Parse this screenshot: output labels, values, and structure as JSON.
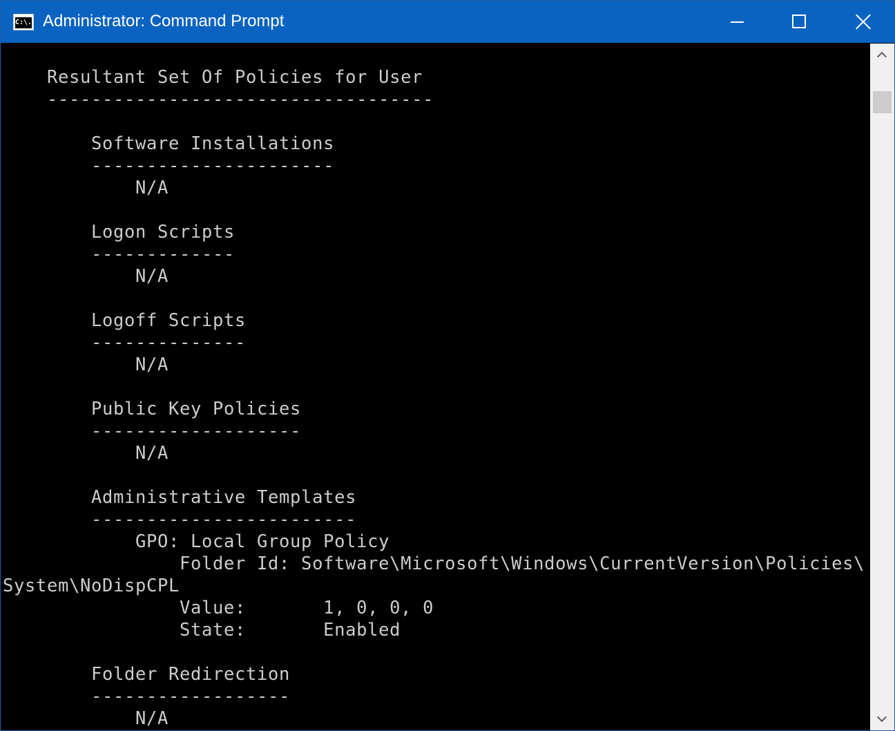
{
  "window": {
    "title": "Administrator: Command Prompt",
    "icon": "cmd-app-icon",
    "icon_text": "C:\\.",
    "controls": [
      "minimize-icon",
      "maximize-icon",
      "close-icon"
    ]
  },
  "console": {
    "lines": [
      "    Resultant Set Of Policies for User",
      "    -----------------------------------",
      "",
      "        Software Installations",
      "        ----------------------",
      "            N/A",
      "",
      "        Logon Scripts",
      "        -------------",
      "            N/A",
      "",
      "        Logoff Scripts",
      "        --------------",
      "            N/A",
      "",
      "        Public Key Policies",
      "        -------------------",
      "            N/A",
      "",
      "        Administrative Templates",
      "        ------------------------",
      "            GPO: Local Group Policy",
      "                Folder Id: Software\\Microsoft\\Windows\\CurrentVersion\\Policies\\",
      "System\\NoDispCPL",
      "                Value:       1, 0, 0, 0",
      "                State:       Enabled",
      "",
      "        Folder Redirection",
      "        ------------------",
      "            N/A"
    ]
  },
  "colors": {
    "titlebar": "#0a63c1",
    "console_bg": "#000000",
    "console_text": "#cccccc"
  }
}
